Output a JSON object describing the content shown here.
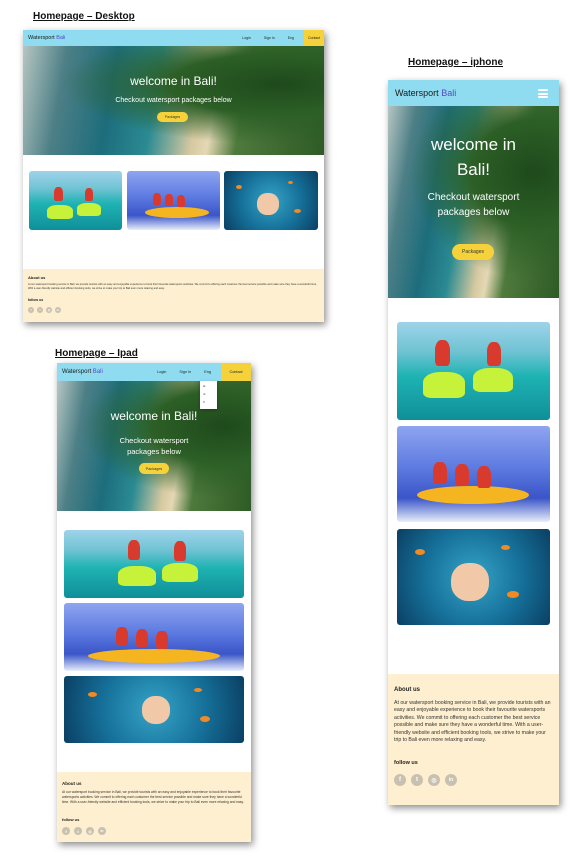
{
  "headings": {
    "desktop": "Homepage – Desktop",
    "iphone": "Homepage – iphone",
    "ipad": "Homepage – Ipad"
  },
  "brand": {
    "name": "Watersport",
    "accent": "Bali"
  },
  "nav": {
    "login": "Login",
    "signin": "Sign In",
    "lang": "Eng",
    "contact": "Contact"
  },
  "lang_options": [
    "id",
    "nl",
    "fr"
  ],
  "hero": {
    "title": "welcome in Bali!",
    "subtitle": "Checkout watersport packages below",
    "button": "Packages"
  },
  "photos": [
    {
      "name": "jetski-photo"
    },
    {
      "name": "banana-boat-photo"
    },
    {
      "name": "snorkeling-photo"
    }
  ],
  "footer": {
    "about_heading": "About us",
    "about_text": "At our watersport booking service in Bali, we provide tourists with an easy and enjoyable experience to book their favourite watersports activities. We commit to offering each customer the best service possible and make sure they have a wonderful time. With a user-friendly website and efficient booking tools, we strive to make your trip to Bali even more relaxing and easy.",
    "follow": "follow us",
    "socials": [
      "facebook-icon",
      "twitter-icon",
      "instagram-icon",
      "linkedin-icon"
    ]
  },
  "colors": {
    "nav": "#8fdcf0",
    "accent": "#5b46c9",
    "button": "#f6d23a",
    "footer": "#fdefcf"
  }
}
